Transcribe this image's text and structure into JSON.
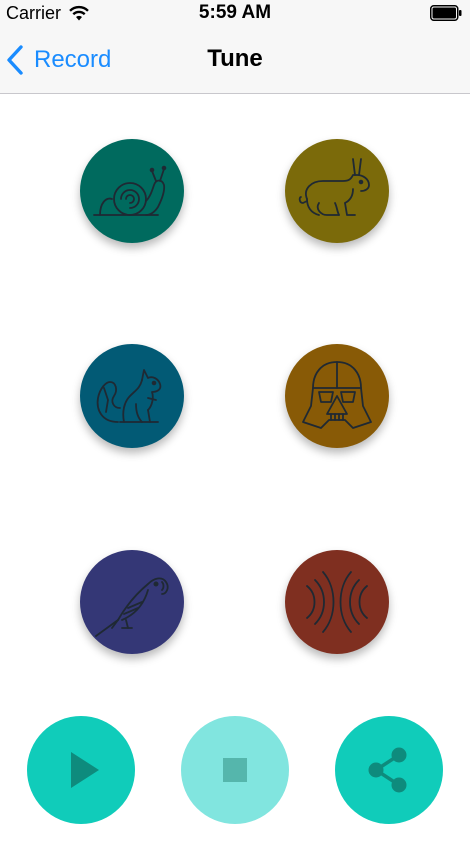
{
  "status_bar": {
    "carrier": "Carrier",
    "time": "5:59 AM",
    "wifi_icon": "wifi-icon",
    "battery_icon": "battery-full-icon"
  },
  "nav": {
    "back_label": "Record",
    "title": "Tune"
  },
  "effects": [
    {
      "name": "slow",
      "icon": "snail-icon",
      "color": "#006a5e"
    },
    {
      "name": "fast",
      "icon": "rabbit-icon",
      "color": "#7b6a0a"
    },
    {
      "name": "chipmunk",
      "icon": "squirrel-icon",
      "color": "#025a75"
    },
    {
      "name": "vader",
      "icon": "darth-vader-icon",
      "color": "#885a06"
    },
    {
      "name": "parrot",
      "icon": "parrot-icon",
      "color": "#343776"
    },
    {
      "name": "echo",
      "icon": "echo-wave-icon",
      "color": "#7f2f20"
    }
  ],
  "controls": {
    "play": {
      "icon": "play-icon",
      "color": "#10ccba"
    },
    "stop": {
      "icon": "stop-icon",
      "color": "#81e5df",
      "state": "disabled"
    },
    "share": {
      "icon": "share-icon",
      "color": "#10ccba"
    }
  },
  "colors": {
    "tint": "#1a8cff",
    "icon_stroke": "#1f2933"
  }
}
